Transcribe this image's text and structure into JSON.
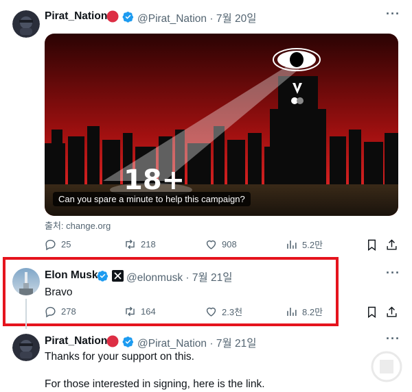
{
  "tweet1": {
    "name": "Pirat_Nation",
    "handle": "@Pirat_Nation",
    "dot": "·",
    "date": "7월 20일",
    "card_title": "Can you spare a minute to help this campaign?",
    "image_text": "18+",
    "source_label": "출처: change.org",
    "stats": {
      "replies": "25",
      "retweets": "218",
      "likes": "908",
      "views": "5.2만"
    }
  },
  "tweet2": {
    "name": "Elon Musk",
    "handle": "@elonmusk",
    "dot": "·",
    "date": "7월 21일",
    "text": "Bravo",
    "stats": {
      "replies": "278",
      "retweets": "164",
      "likes": "2.3천",
      "views": "8.2만"
    }
  },
  "tweet3": {
    "name": "Pirat_Nation",
    "handle": "@Pirat_Nation",
    "dot": "·",
    "date": "7월 21일",
    "line1": "Thanks for your support on this.",
    "line2": "For those interested in signing, here is the link."
  },
  "colors": {
    "verified": "#1d9bf0",
    "highlight_box": "#e5141d",
    "muted": "#536471"
  },
  "icons": [
    "reply-icon",
    "retweet-icon",
    "like-icon",
    "views-icon",
    "bookmark-icon",
    "share-icon",
    "more-icon",
    "verified-icon",
    "x-logo-icon"
  ]
}
